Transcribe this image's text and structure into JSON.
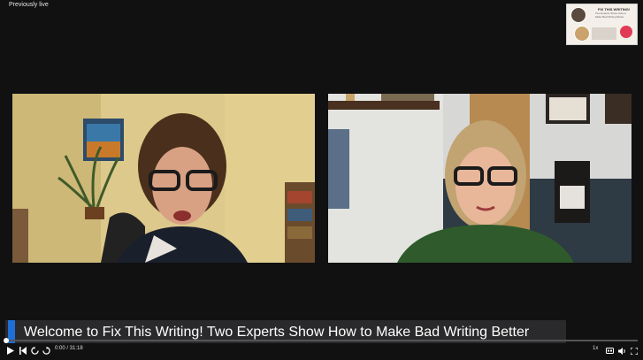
{
  "header": {
    "live_label": "Previously live"
  },
  "thumbnail": {
    "title": "FIX THIS WRITING!",
    "subtitle": "Two Experts Show How to Make Bad Writing Better"
  },
  "caption": {
    "text": "Welcome to Fix This Writing! Two Experts Show How to Make Bad Writing Better"
  },
  "player": {
    "time": "0:00 / 31:18",
    "playback_rate": "1x",
    "progress": 0,
    "accent_color": "#1f6fd6"
  },
  "icons": {
    "play": "play-icon",
    "prev": "skip-previous-icon",
    "rewind": "rewind-10-icon",
    "forward": "forward-10-icon",
    "cc": "closed-captions-icon",
    "volume": "volume-icon",
    "fullscreen": "fullscreen-icon"
  }
}
